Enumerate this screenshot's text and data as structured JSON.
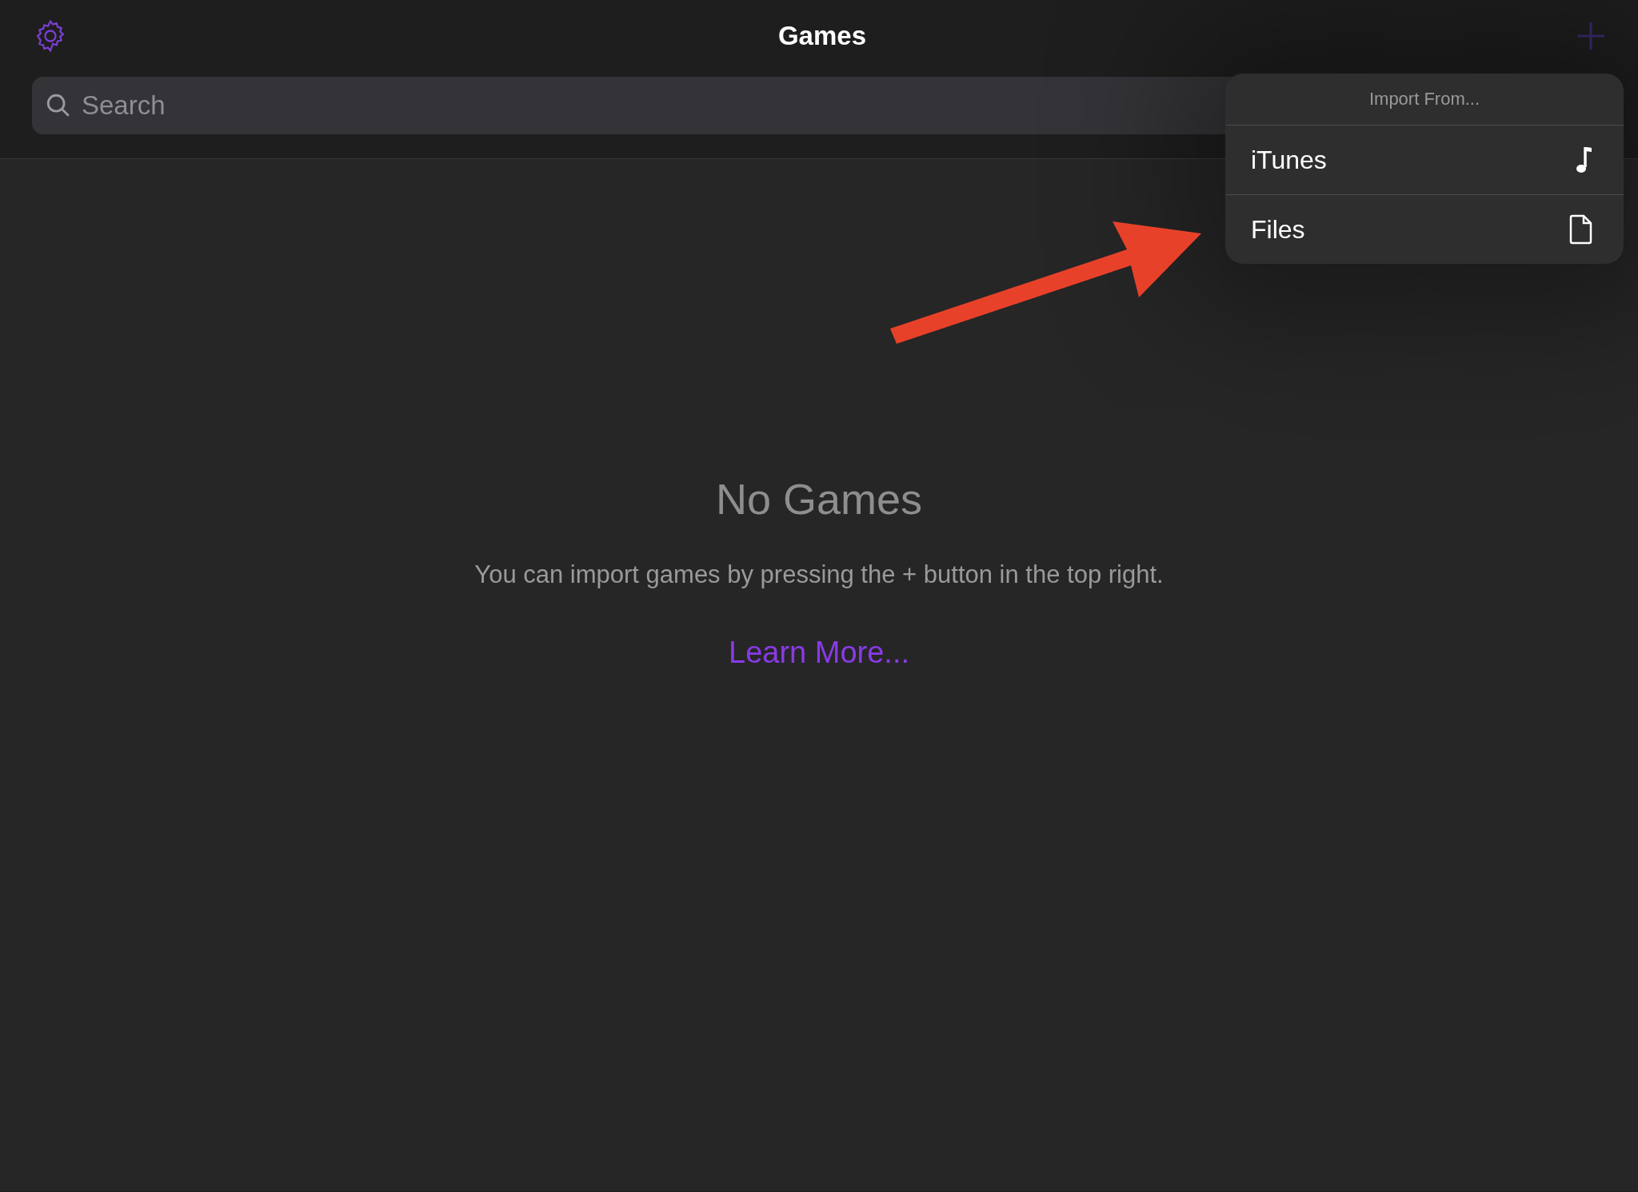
{
  "nav": {
    "title": "Games"
  },
  "search": {
    "placeholder": "Search"
  },
  "import_menu": {
    "title": "Import From...",
    "items": [
      {
        "label": "iTunes",
        "kind": "music"
      },
      {
        "label": "Files",
        "kind": "document"
      }
    ]
  },
  "empty_state": {
    "title": "No Games",
    "message": "You can import games by pressing the + button in the top right.",
    "link": "Learn More..."
  }
}
